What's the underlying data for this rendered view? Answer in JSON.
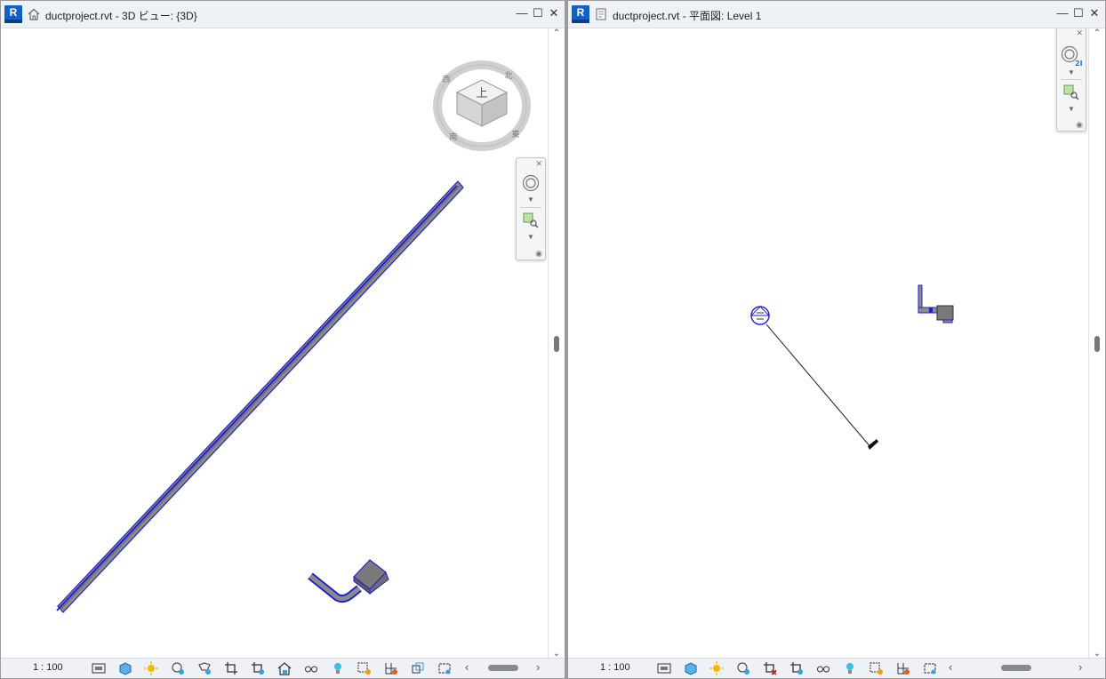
{
  "left_window": {
    "app_logo": "R",
    "view_icon": "house-3d-view-icon",
    "title": "ductproject.rvt - 3D ビュー: {3D}",
    "scale": "1 : 100",
    "viewcube_face_label": "上",
    "viewcube_compass_labels": [
      "北",
      "東",
      "南",
      "西"
    ]
  },
  "right_window": {
    "app_logo": "R",
    "view_icon": "plan-view-icon",
    "title": "ductproject.rvt - 平面図: Level 1",
    "scale": "1 : 100",
    "nav_2d_label": "2D"
  },
  "colors": {
    "duct_fill": "#8c8c8c",
    "duct_edge": "#2222cc",
    "logo_blue": "#1060c8"
  }
}
